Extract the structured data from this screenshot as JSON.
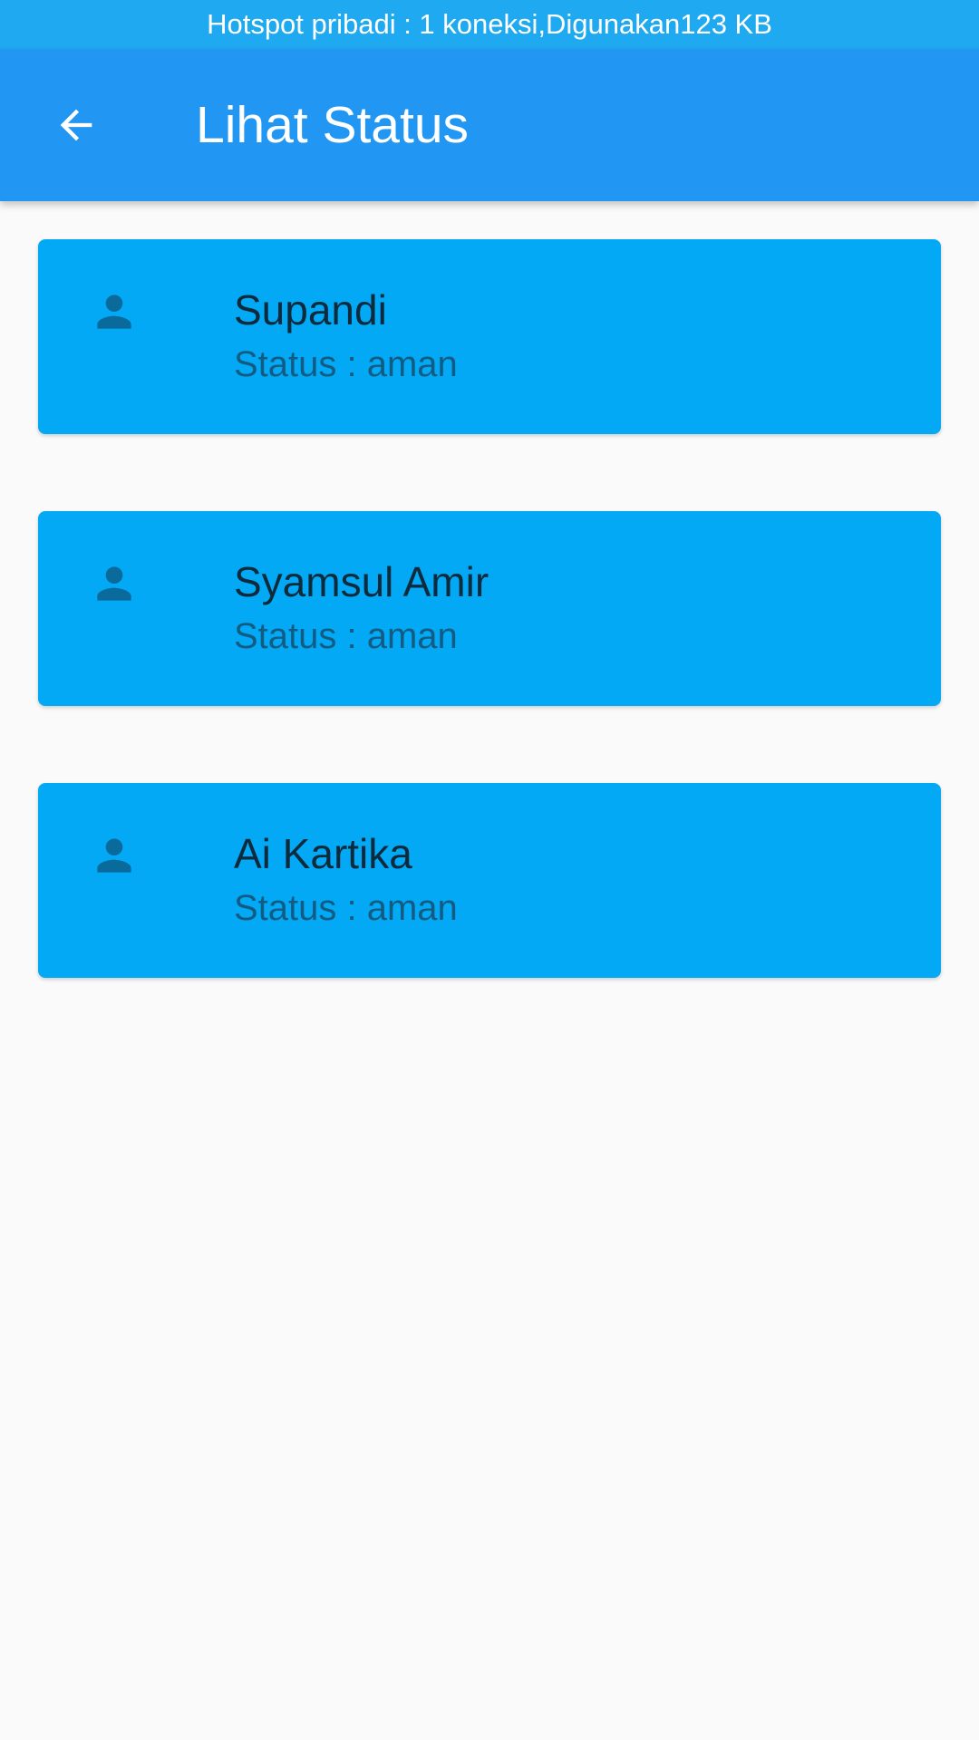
{
  "status_bar": {
    "text": "Hotspot pribadi : 1 koneksi,Digunakan123 KB"
  },
  "app_bar": {
    "back_icon": "arrow-back-icon",
    "title": "Lihat Status"
  },
  "people": [
    {
      "name": "Supandi",
      "status": "Status : aman",
      "icon": "person-icon"
    },
    {
      "name": "Syamsul Amir",
      "status": "Status : aman",
      "icon": "person-icon"
    },
    {
      "name": "Ai Kartika",
      "status": "Status : aman",
      "icon": "person-icon"
    }
  ],
  "colors": {
    "status_bar": "#1fa9f1",
    "app_bar": "#2196f3",
    "card": "#03a9f4",
    "background": "#fafafa"
  }
}
